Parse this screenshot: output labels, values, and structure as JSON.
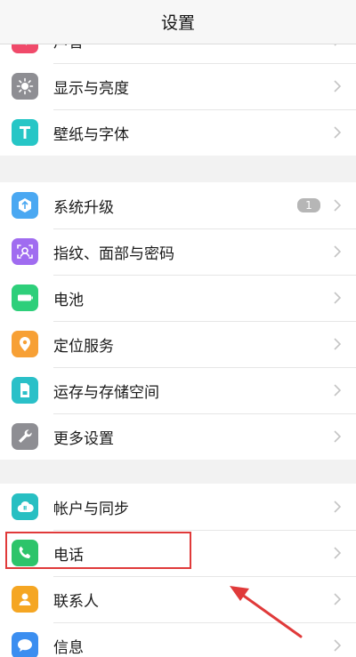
{
  "header": {
    "title": "设置"
  },
  "groups": [
    {
      "items": [
        {
          "label": "声音",
          "icon": "sound-icon",
          "color": "#f04a6a"
        },
        {
          "label": "显示与亮度",
          "icon": "brightness-icon",
          "color": "#8e8e93"
        },
        {
          "label": "壁纸与字体",
          "icon": "text-t-icon",
          "color": "#26c6c6"
        }
      ]
    },
    {
      "items": [
        {
          "label": "系统升级",
          "icon": "upgrade-icon",
          "color": "#4aa8f2",
          "badge": "1"
        },
        {
          "label": "指纹、面部与密码",
          "icon": "face-id-icon",
          "color": "#a06cf0"
        },
        {
          "label": "电池",
          "icon": "battery-icon",
          "color": "#2ecf7a"
        },
        {
          "label": "定位服务",
          "icon": "location-icon",
          "color": "#f7a035"
        },
        {
          "label": "运存与存储空间",
          "icon": "storage-icon",
          "color": "#2ac0c8"
        },
        {
          "label": "更多设置",
          "icon": "wrench-icon",
          "color": "#8e8e93"
        }
      ]
    },
    {
      "items": [
        {
          "label": "帐户与同步",
          "icon": "cloud-sync-icon",
          "color": "#27bfc2"
        },
        {
          "label": "电话",
          "icon": "phone-icon",
          "color": "#2dc46a"
        },
        {
          "label": "联系人",
          "icon": "contact-icon",
          "color": "#f5a623"
        },
        {
          "label": "信息",
          "icon": "message-icon",
          "color": "#3b8ef0"
        }
      ]
    }
  ]
}
